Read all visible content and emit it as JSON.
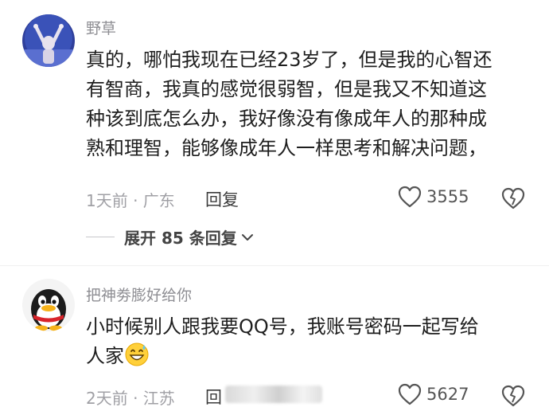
{
  "comments": [
    {
      "username": "野草",
      "text_lines": [
        "真的，哪怕我现在已经23岁了，但是我的心智还",
        "有智商，我真的感觉很弱智，但是我又不知道这",
        "种该到底怎么办，我好像没有像成年人的那种成",
        "熟和理智，能够像成年人一样思考和解决问题，"
      ],
      "meta": "1天前 · 广东",
      "reply_label": "回复",
      "likes": "3555",
      "expand_label": "展开 85 条回复"
    },
    {
      "username": "把神劵膨好给你",
      "text_lines": [
        "小时候别人跟我要QQ号，我账号密码一起写给",
        "人家"
      ],
      "emoji": "grinning-sweat-emoji",
      "meta": "2天前 · 江苏",
      "reply_label": "回",
      "likes": "5627"
    }
  ],
  "colors": {
    "username": "#8e8e93",
    "text": "#1e1e1e",
    "meta": "#a0a0a5",
    "emoji_yellow": "#ffd03a"
  }
}
